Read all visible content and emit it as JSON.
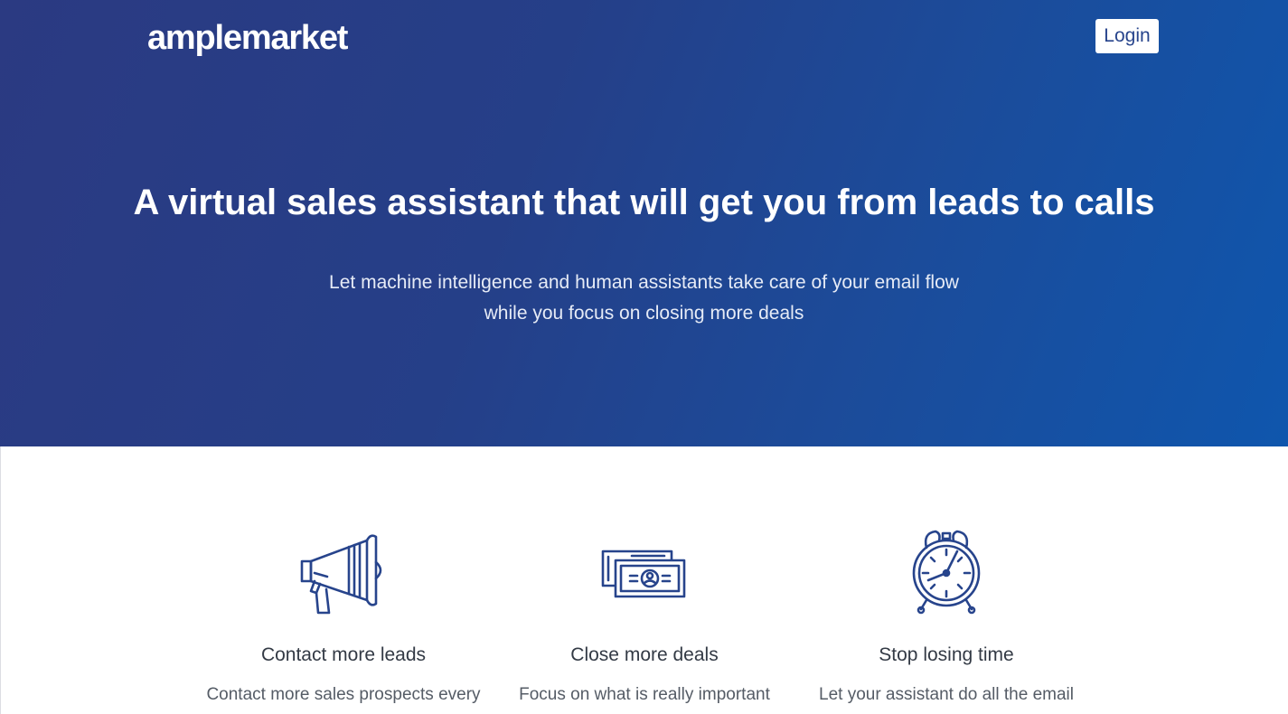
{
  "header": {
    "logo": "amplemarket",
    "login_label": "Login"
  },
  "hero": {
    "headline": "A virtual sales assistant that will get you from leads to calls",
    "subheadline": "Let machine intelligence and human assistants take care of your email flow while you focus on closing more deals"
  },
  "features": [
    {
      "icon": "megaphone-icon",
      "title": "Contact more leads",
      "description": "Contact more sales prospects every"
    },
    {
      "icon": "money-bills-icon",
      "title": "Close more deals",
      "description": "Focus on what is really important"
    },
    {
      "icon": "alarm-clock-icon",
      "title": "Stop losing time",
      "description": "Let your assistant do all the email"
    }
  ],
  "colors": {
    "hero_gradient_start": "#2b3a82",
    "hero_gradient_end": "#0f56ad",
    "icon_stroke": "#27448c",
    "text_dark": "#333a45"
  }
}
